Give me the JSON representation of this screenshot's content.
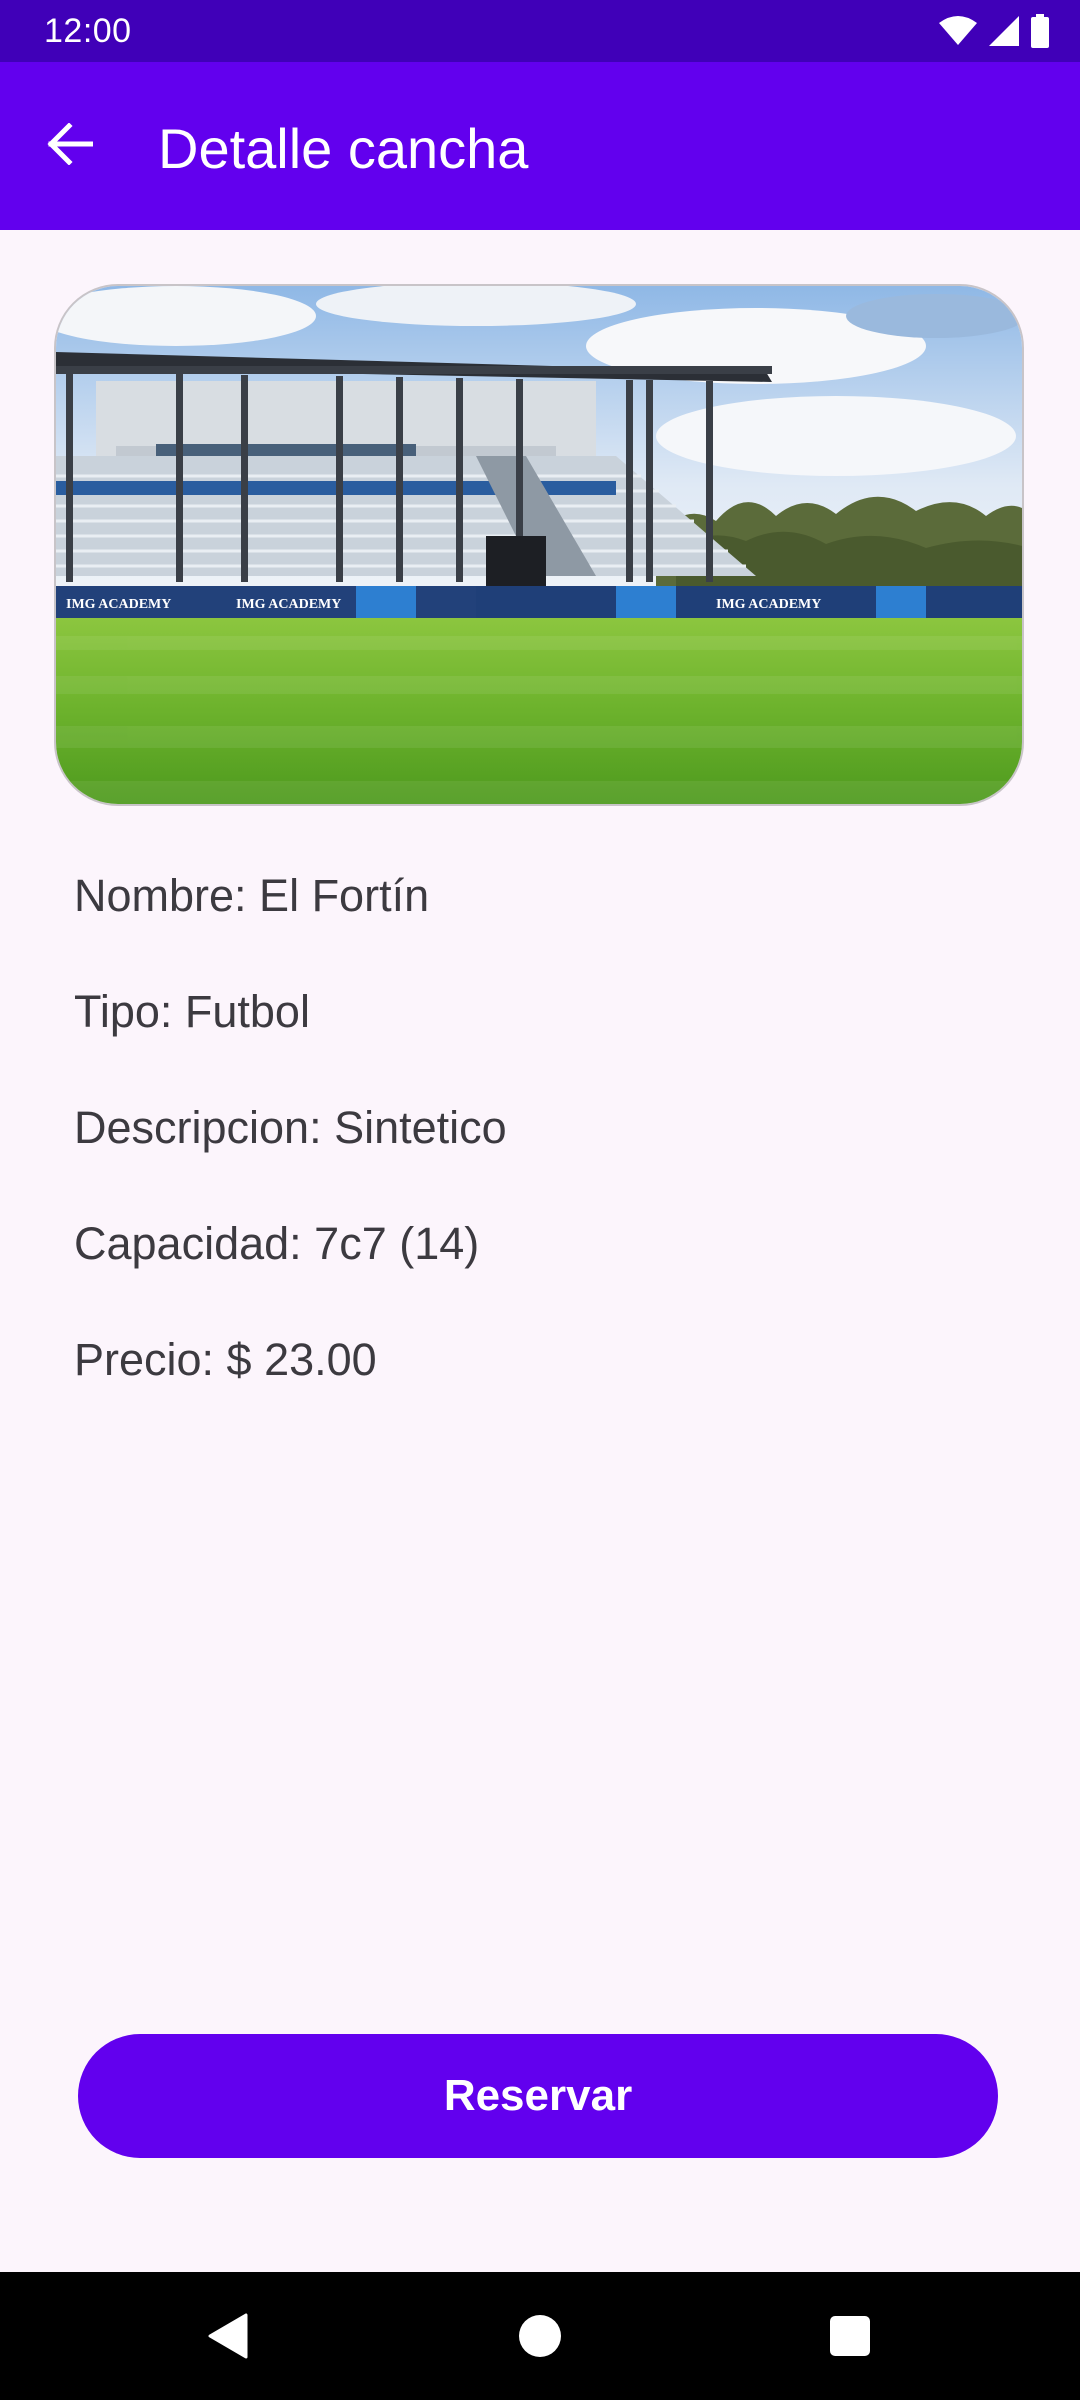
{
  "status_bar": {
    "time": "12:00",
    "icons": [
      "wifi-icon",
      "signal-icon",
      "battery-icon"
    ]
  },
  "app_bar": {
    "back_icon": "arrow-back-icon",
    "title": "Detalle cancha"
  },
  "field": {
    "image": "stadium-field-photo",
    "banner_text": "IMG ACADEMY",
    "nombre": "Nombre: El Fortín",
    "tipo": "Tipo: Futbol",
    "descripcion": "Descripcion: Sintetico",
    "capacidad": "Capacidad: 7c7 (14)",
    "precio": "Precio: $ 23.00"
  },
  "actions": {
    "reserve_label": "Reservar"
  },
  "nav_bar": {
    "icons": [
      "nav-back-icon",
      "nav-home-icon",
      "nav-recents-icon"
    ]
  },
  "colors": {
    "status_bar": "#4000B8",
    "primary": "#6200EE",
    "background": "#FCF5FC",
    "text": "#3C3A40",
    "nav_bar": "#000000"
  }
}
